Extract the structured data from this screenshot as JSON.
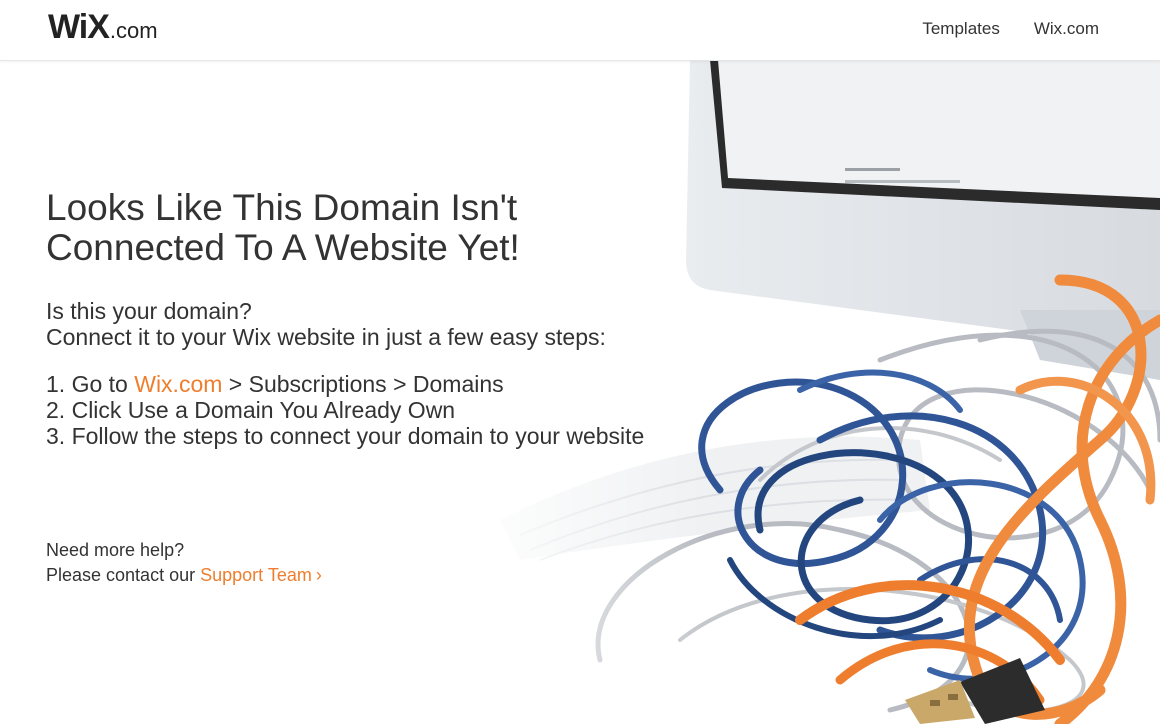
{
  "header": {
    "logo_main": "WiX",
    "logo_suffix": ".com",
    "nav": [
      {
        "label": "Templates"
      },
      {
        "label": "Wix.com"
      }
    ]
  },
  "main": {
    "title_line1": "Looks Like This Domain Isn't",
    "title_line2": "Connected To A Website Yet!",
    "intro_line1": "Is this your domain?",
    "intro_line2": "Connect it to your Wix website in just a few easy steps:",
    "steps": [
      {
        "number": "1.",
        "prefix": "Go to",
        "link": "Wix.com",
        "suffix": "> Subscriptions > Domains"
      },
      {
        "number": "2.",
        "text": "Click Use a Domain You Already Own"
      },
      {
        "number": "3.",
        "text": "Follow the steps to connect your domain to your website"
      }
    ],
    "help_line1": "Need more help?",
    "help_line2_prefix": "Please contact our",
    "support_link": "Support Team",
    "support_chevron": "›"
  },
  "colors": {
    "accent": "#ee7e2d",
    "text": "#333333",
    "cable_blue": "#2f5597",
    "cable_orange": "#f08a3c",
    "cable_gray": "#b8bcc2"
  },
  "illustration": {
    "icons": [
      "computer-monitor-icon",
      "keyboard-icon",
      "tangled-cables-icon",
      "usb-plug-icon"
    ]
  }
}
